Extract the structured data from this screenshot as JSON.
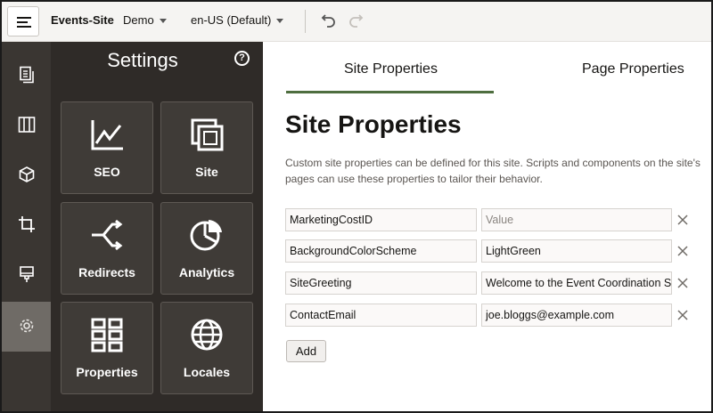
{
  "topbar": {
    "site_name": "Events-Site",
    "repository": "Demo",
    "locale": "en-US (Default)"
  },
  "rail": {
    "items": [
      "pages-icon",
      "components-icon",
      "themes-icon",
      "crop-icon",
      "stamp-icon",
      "gear-icon"
    ],
    "active": "gear-icon"
  },
  "panel": {
    "title": "Settings",
    "tiles": [
      {
        "label": "SEO",
        "icon": "seo-chart-icon"
      },
      {
        "label": "Site",
        "icon": "site-pages-icon"
      },
      {
        "label": "Redirects",
        "icon": "redirects-icon"
      },
      {
        "label": "Analytics",
        "icon": "analytics-pie-icon"
      },
      {
        "label": "Properties",
        "icon": "properties-grid-icon"
      },
      {
        "label": "Locales",
        "icon": "globe-icon"
      }
    ]
  },
  "main": {
    "tabs": [
      "Site Properties",
      "Page Properties"
    ],
    "active_tab": "Site Properties",
    "heading": "Site Properties",
    "description": "Custom site properties can be defined for this site. Scripts and components on the site's pages can use these properties to tailor their behavior.",
    "properties": [
      {
        "name": "MarketingCostID",
        "value": "",
        "value_placeholder": "Value"
      },
      {
        "name": "BackgroundColorScheme",
        "value": "LightGreen"
      },
      {
        "name": "SiteGreeting",
        "value": "Welcome to the Event Coordination Si"
      },
      {
        "name": "ContactEmail",
        "value": "joe.bloggs@example.com"
      }
    ],
    "add_label": "Add"
  },
  "colors": {
    "rail_bg": "#3a3632",
    "panel_bg": "#2f2b28",
    "tile_bg": "#3f3b37",
    "accent_underline": "#4e6e3f"
  }
}
